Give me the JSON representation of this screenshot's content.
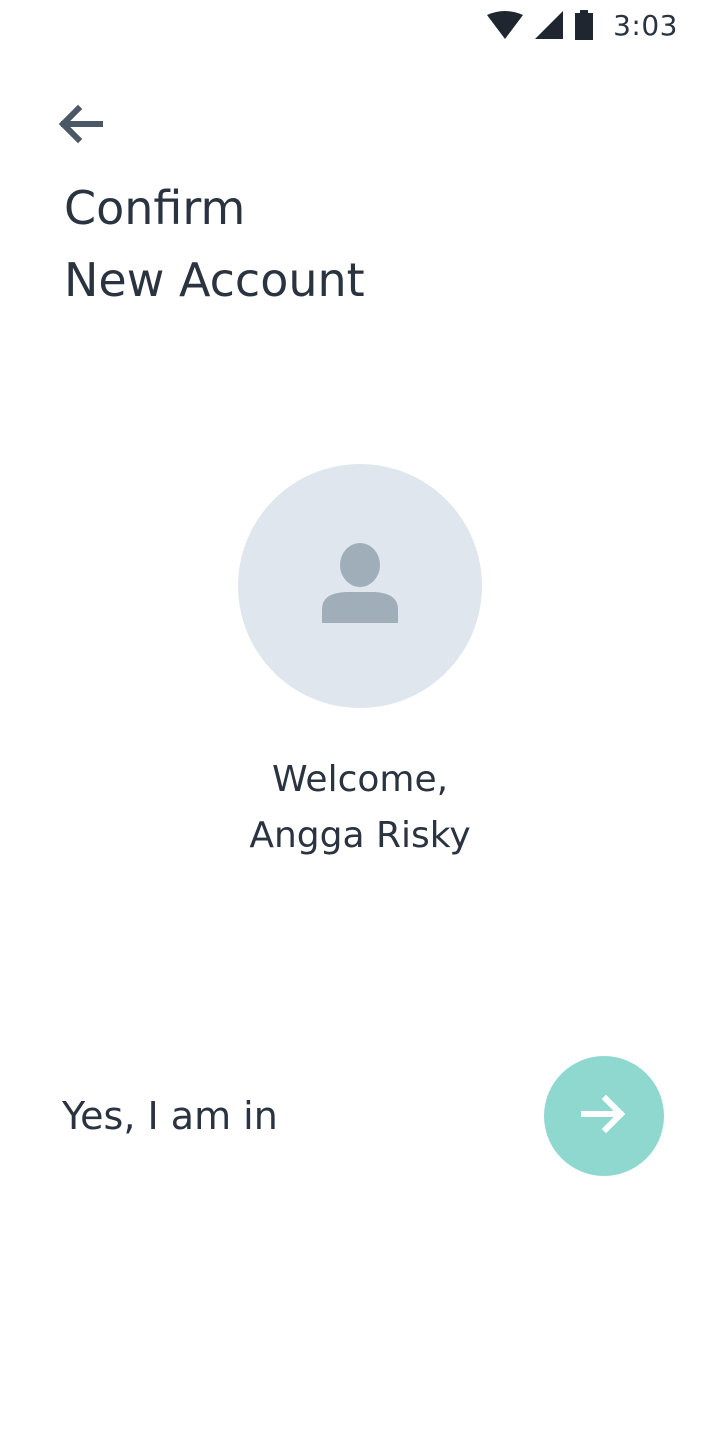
{
  "status_bar": {
    "time": "3:03",
    "icons": [
      "wifi-icon",
      "cellular-signal-icon",
      "battery-icon"
    ]
  },
  "header": {
    "back_icon": "arrow-left-icon",
    "title_line1": "Confirm",
    "title_line2": "New Account"
  },
  "profile": {
    "avatar_icon": "person-icon",
    "welcome_line1": "Welcome,",
    "welcome_line2": "Angga Risky"
  },
  "confirm": {
    "label": "Yes, I am in",
    "button_icon": "arrow-right-icon"
  },
  "colors": {
    "text": "#2a3441",
    "avatar_bg": "#e0e6ee",
    "avatar_icon": "#a0aeba",
    "accent": "#8fd8cf"
  }
}
